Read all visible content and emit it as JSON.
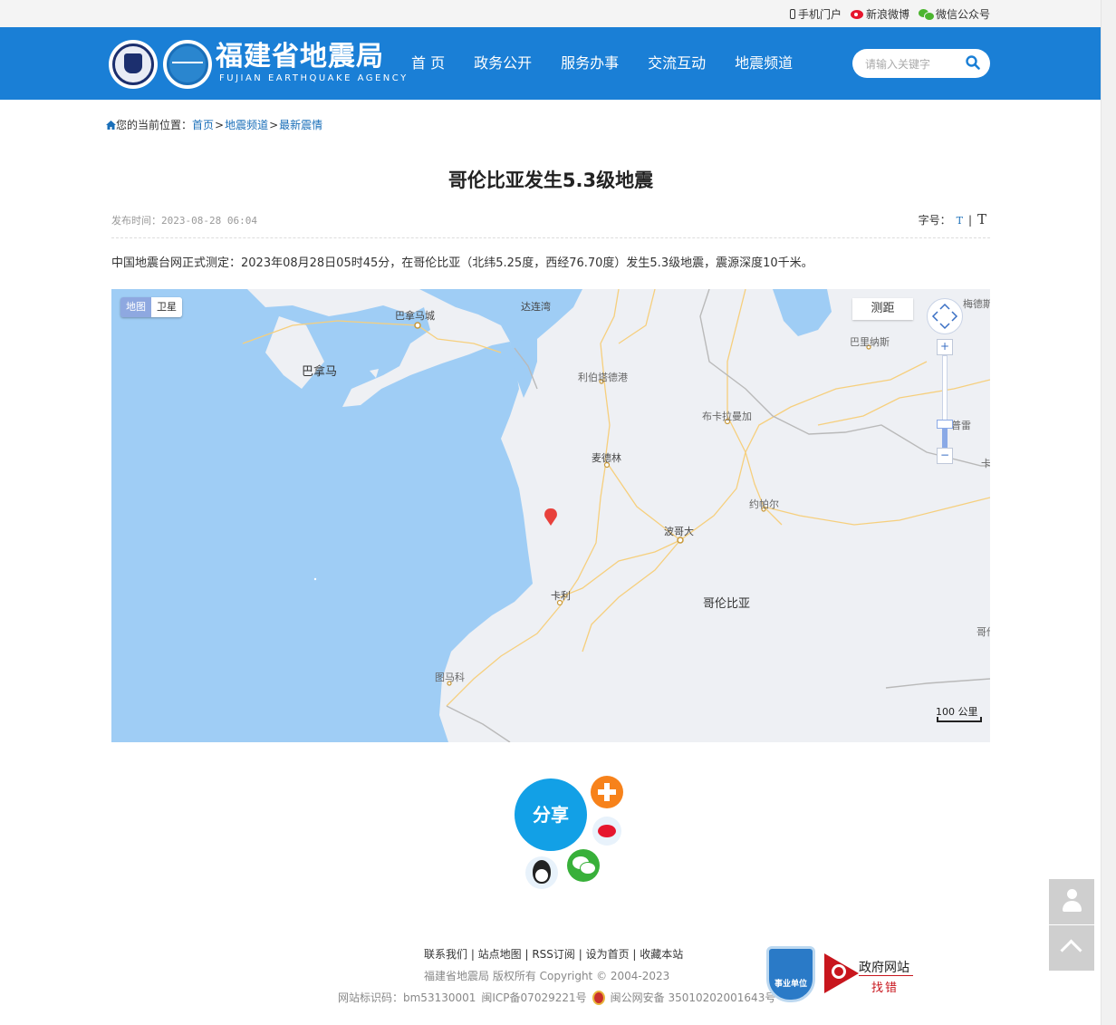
{
  "topbar": {
    "mobile": "手机门户",
    "weibo": "新浪微博",
    "wechat": "微信公众号"
  },
  "header": {
    "logo_cn": "福建省地震局",
    "logo_en": "FUJIAN EARTHQUAKE AGENCY",
    "nav": [
      "首 页",
      "政务公开",
      "服务办事",
      "交流互动",
      "地震频道"
    ],
    "search_placeholder": "请输入关键字"
  },
  "breadcrumb": {
    "prefix": "您的当前位置：",
    "items": [
      "首页",
      "地震频道",
      "最新震情"
    ],
    "sep": ">"
  },
  "article": {
    "title": "哥伦比亚发生5.3级地震",
    "date_label": "发布时间：",
    "date": "2023-08-28 06:04",
    "font_size_label": "字号：",
    "font_small": "T",
    "font_sep": "|",
    "font_large": "T",
    "body": "中国地震台网正式测定：2023年08月28日05时45分，在哥伦比亚（北纬5.25度，西经76.70度）发生5.3级地震，震源深度10千米。"
  },
  "map": {
    "type_map": "地图",
    "type_satellite": "卫星",
    "measure": "测距",
    "zoom_in": "+",
    "zoom_out": "−",
    "zoom_level_fraction": 0.25,
    "scale": "100 公里",
    "labels": {
      "dalian_gulf": "达连湾",
      "panama_city": "巴拿马城",
      "panama": "巴拿马",
      "liberia": "利伯塔德港",
      "bucaramanga": "布卡拉曼加",
      "medellin": "麦德林",
      "yopal": "约帕尔",
      "bogota": "波哥大",
      "cali": "卡利",
      "colombia": "哥伦比亚",
      "tumaco": "图马科",
      "barinas": "巴里纳斯",
      "merida": "梅德斯",
      "guanare": "普雷",
      "edge_right": "卡",
      "edge_right2": "哥伦"
    },
    "colors": {
      "water": "#9fcdf5",
      "land": "#eef0f4",
      "roads": "#f6cf7d",
      "border": "#b9b9b9",
      "marker": "#e8413c"
    }
  },
  "share": {
    "label": "分享"
  },
  "footer": {
    "links": "联系我们 | 站点地图 | RSS订阅 | 设为首页 | 收藏本站",
    "copyright": "福建省地震局   版权所有    Copyright © 2004-2023",
    "site_id": "网站标识码：bm53130001",
    "icp": "闽ICP备07029221号",
    "police": "闽公网安备 35010202001643号",
    "badge": "事业单位",
    "gov_title": "政府网站",
    "gov_sub": "找错"
  }
}
